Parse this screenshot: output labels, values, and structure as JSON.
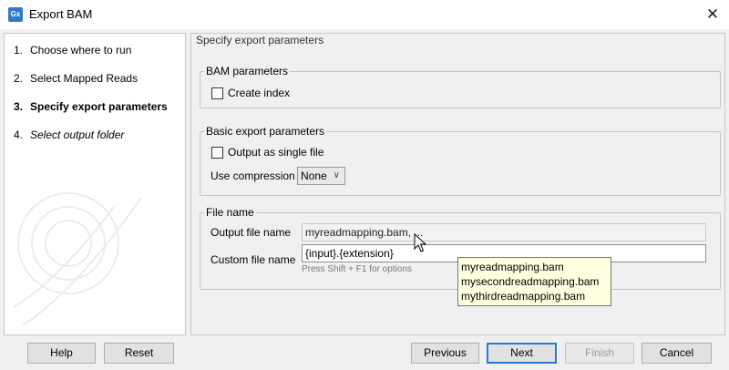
{
  "window": {
    "title": "Export BAM",
    "app_icon_text": "Gx"
  },
  "steps": [
    {
      "num": "1.",
      "label": "Choose where to run",
      "state": "done"
    },
    {
      "num": "2.",
      "label": "Select Mapped Reads",
      "state": "done"
    },
    {
      "num": "3.",
      "label": "Specify export parameters",
      "state": "active"
    },
    {
      "num": "4.",
      "label": "Select output folder",
      "state": "future"
    }
  ],
  "panel": {
    "title": "Specify export parameters",
    "bam_group": {
      "title": "BAM parameters",
      "create_index_label": "Create index",
      "create_index_checked": false
    },
    "basic_group": {
      "title": "Basic export parameters",
      "single_file_label": "Output as single file",
      "single_file_checked": false,
      "compression_label": "Use compression",
      "compression_value": "None"
    },
    "filename_group": {
      "title": "File name",
      "output_label": "Output file name",
      "output_value": "myreadmapping.bam, ...",
      "custom_label": "Custom file name",
      "custom_value": "{input}.{extension}",
      "hint": "Press Shift + F1 for options"
    }
  },
  "tooltip": {
    "lines": [
      "myreadmapping.bam",
      "mysecondreadmapping.bam",
      "mythirdreadmapping.bam"
    ]
  },
  "buttons": {
    "help": "Help",
    "reset": "Reset",
    "previous": "Previous",
    "next": "Next",
    "finish": "Finish",
    "cancel": "Cancel"
  },
  "colors": {
    "accent": "#2b78d6",
    "tooltip_bg": "#ffffe1",
    "app_icon": "#2f7cc4"
  }
}
